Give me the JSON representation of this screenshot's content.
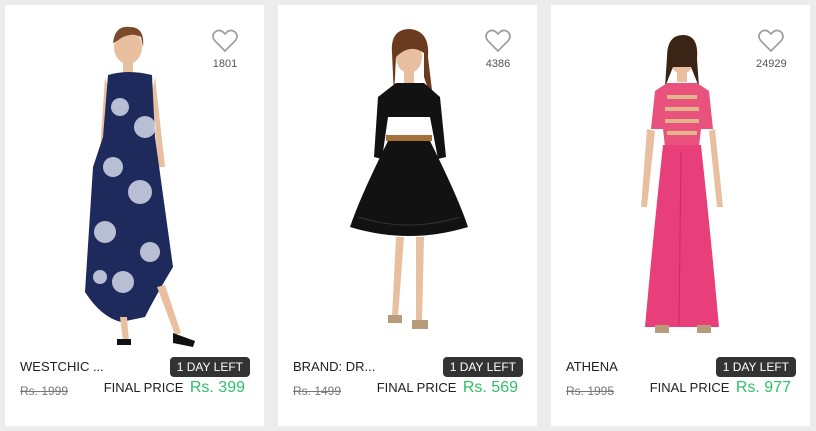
{
  "products": [
    {
      "brand": "WESTCHIC ...",
      "wishlist_count": "1801",
      "badge": "1 DAY LEFT",
      "mrp": "Rs. 1999",
      "final_label": "FINAL PRICE",
      "final_price": "Rs. 399",
      "dress_color": "#1f2a5c"
    },
    {
      "brand": "BRAND: DR...",
      "wishlist_count": "4386",
      "badge": "1 DAY LEFT",
      "mrp": "Rs. 1499",
      "final_label": "FINAL PRICE",
      "final_price": "Rs. 569",
      "dress_color": "#121212"
    },
    {
      "brand": "ATHENA",
      "wishlist_count": "24929",
      "badge": "1 DAY LEFT",
      "mrp": "Rs. 1995",
      "final_label": "FINAL PRICE",
      "final_price": "Rs. 977",
      "dress_color": "#e83e7a"
    }
  ],
  "colors": {
    "price_green": "#2ebf67",
    "badge_bg": "#333333",
    "page_bg": "#ececec"
  },
  "icons": {
    "wishlist": "heart-outline-icon"
  }
}
